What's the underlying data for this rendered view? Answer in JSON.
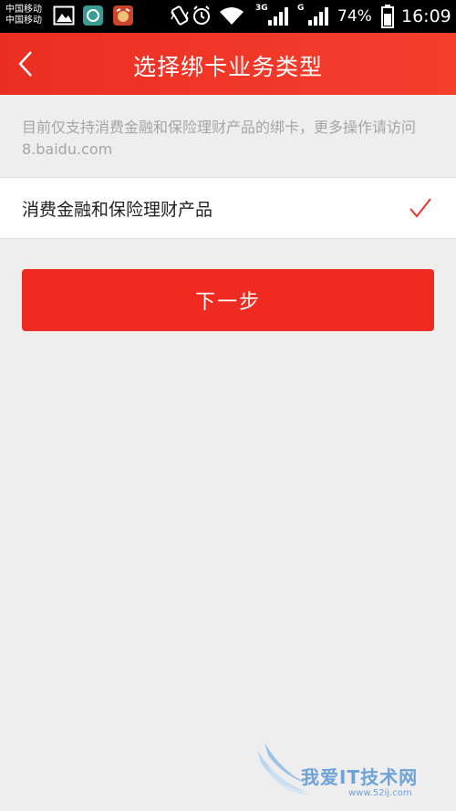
{
  "status_bar": {
    "carrier_line1": "中国移动",
    "carrier_line2": "中国移动",
    "network_3g": "3G",
    "network_g": "G",
    "battery_percent": "74%",
    "time": "16:09"
  },
  "nav": {
    "title": "选择绑卡业务类型"
  },
  "notice": {
    "text": "目前仅支持消费金融和保险理财产品的绑卡，更多操作请访问8.baidu.com"
  },
  "option": {
    "label": "消费金融和保险理财产品",
    "selected": true
  },
  "next_button": {
    "label": "下一步"
  },
  "watermark": {
    "text": "我爱IT技术网",
    "url": "www.52ij.com"
  },
  "colors": {
    "brand_red": "#ef2a20",
    "background": "#eeeeee",
    "hint_text": "#a5a5a5"
  }
}
